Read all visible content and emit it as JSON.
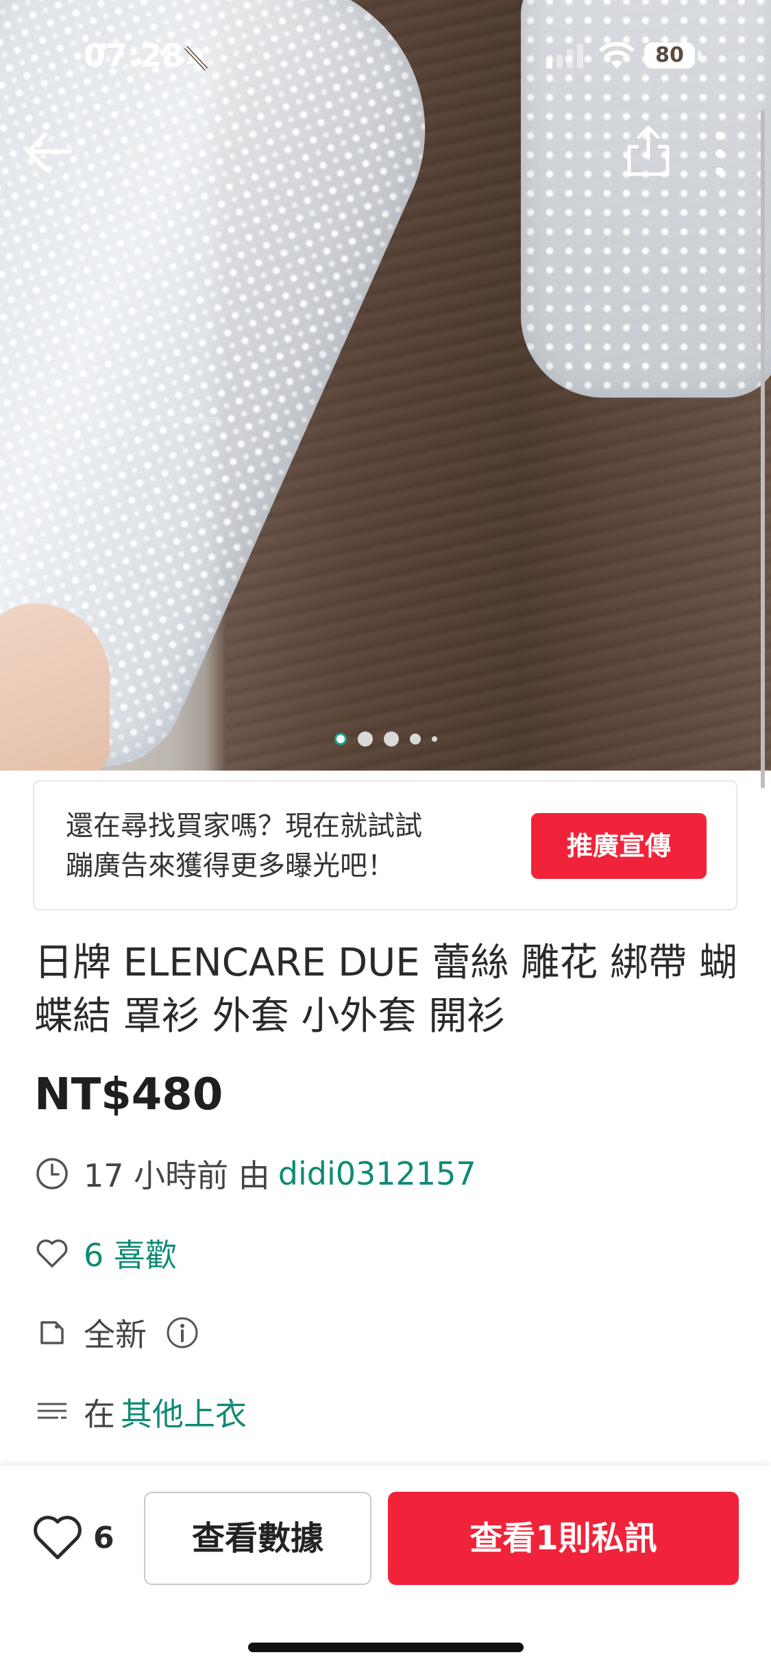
{
  "status_bar": {
    "time": "07:28",
    "battery": "80"
  },
  "promo": {
    "line1": "還在尋找買家嗎？現在就試試",
    "line2": "蹦廣告來獲得更多曝光吧！",
    "button_label": "推廣宣傳"
  },
  "listing": {
    "title": "日牌 ELENCARE DUE 蕾絲 雕花 綁帶 蝴蝶結 罩衫 外套 小外套 開衫",
    "price": "NT$480",
    "posted": {
      "time_text": "17 小時前 由 ",
      "seller": "didi0312157"
    },
    "likes_text": "6 喜歡",
    "condition": "全新",
    "category": {
      "prefix": "在 ",
      "name": "其他上衣"
    }
  },
  "carousel": {
    "total": 5,
    "active": 1
  },
  "bottom_bar": {
    "like_count": "6",
    "data_button": "查看數據",
    "chat_button": "查看1則私訊"
  },
  "colors": {
    "accent_red": "#f0233a",
    "link_green": "#0f8a74"
  }
}
